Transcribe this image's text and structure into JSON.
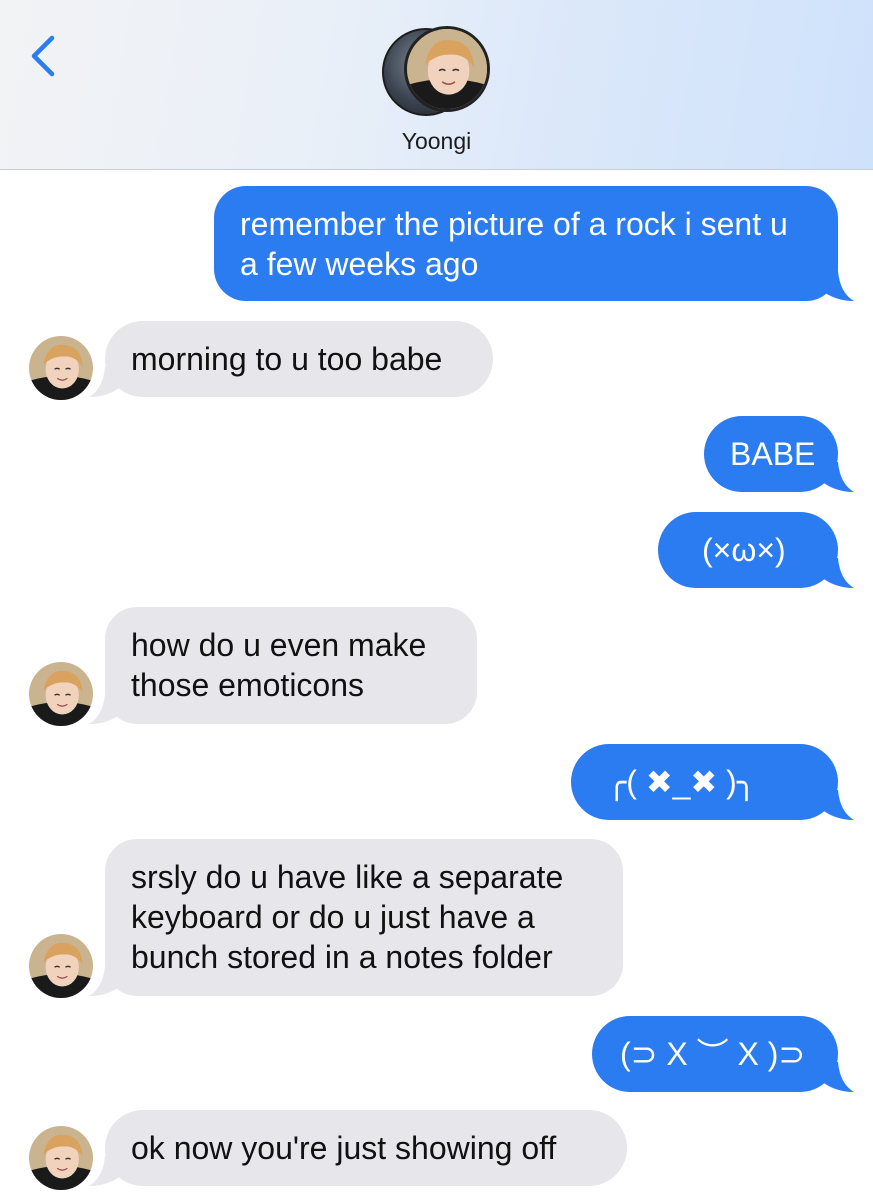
{
  "header": {
    "back_icon": "chevron-left-icon",
    "contact_name": "Yoongi",
    "accent_color": "#2b7cf1"
  },
  "messages": [
    {
      "direction": "sent",
      "text": "remember the picture of a rock i sent u a few weeks ago"
    },
    {
      "direction": "received",
      "text": "morning to u too babe"
    },
    {
      "direction": "sent",
      "text": "BABE"
    },
    {
      "direction": "sent",
      "text": "(×ω×)"
    },
    {
      "direction": "received",
      "text": "how do u even make those emoticons"
    },
    {
      "direction": "sent",
      "text": "╭( ✖_✖ )╮"
    },
    {
      "direction": "received",
      "text": "srsly do u have like a separate keyboard or do u just have a bunch stored in a notes folder"
    },
    {
      "direction": "sent",
      "text": "(⊃ X ︶ X )⊃"
    },
    {
      "direction": "received",
      "text": "ok now you're just showing off"
    }
  ],
  "colors": {
    "sent_bubble": "#2b7cf1",
    "received_bubble": "#e6e6eb"
  }
}
